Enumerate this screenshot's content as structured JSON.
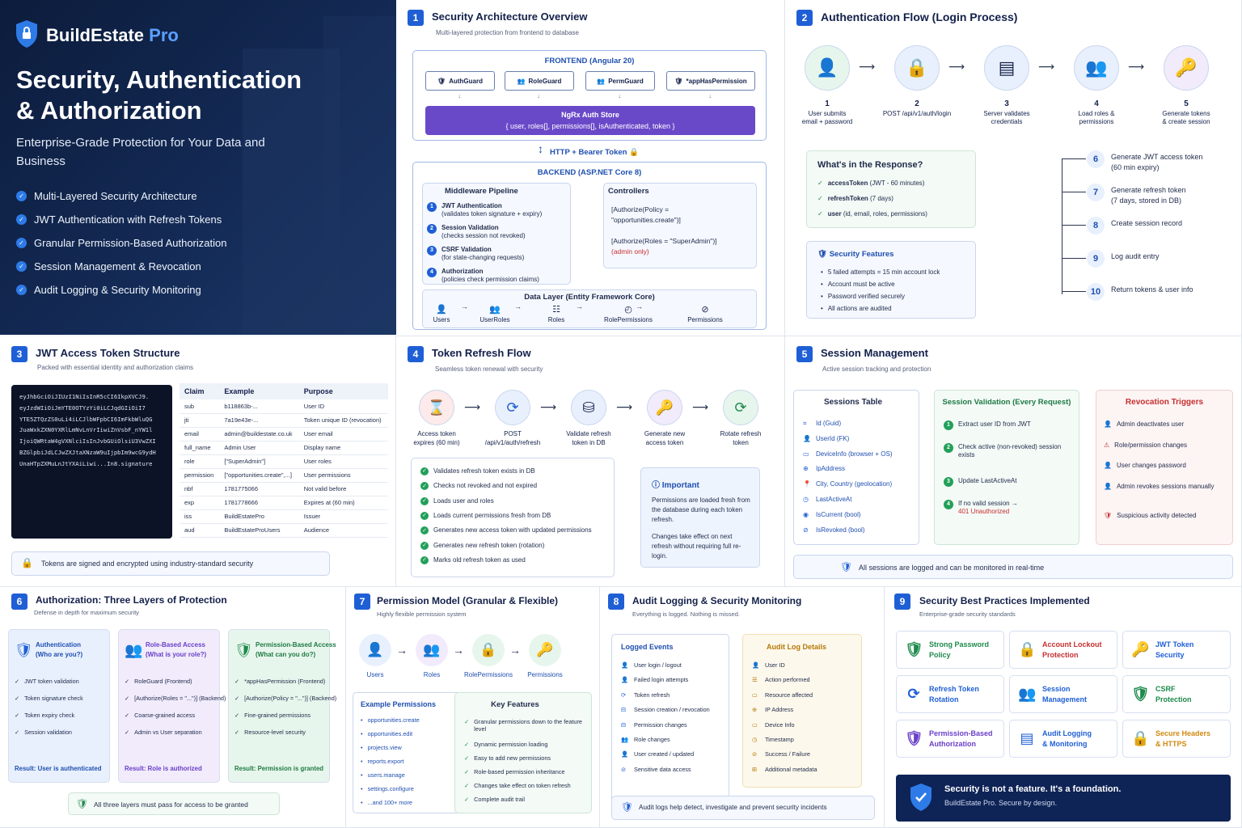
{
  "hero": {
    "brand1": "BuildEstate",
    "brand2": "Pro",
    "title1": "Security, Authentication",
    "title2": "& Authorization",
    "subtitle": "Enterprise-Grade Protection for Your Data and Business",
    "features": [
      "Multi-Layered Security Architecture",
      "JWT Authentication with Refresh Tokens",
      "Granular Permission-Based Authorization",
      "Session Management & Revocation",
      "Audit Logging & Security Monitoring"
    ]
  },
  "p1": {
    "num": "1",
    "title": "Security Architecture Overview",
    "subtitle": "Multi-layered protection from frontend to database",
    "frontend": "FRONTEND (Angular 20)",
    "guards": [
      "AuthGuard",
      "RoleGuard",
      "PermGuard",
      "*appHasPermission"
    ],
    "store_title": "NgRx Auth Store",
    "store_sub": "{ user, roles[], permissions[], isAuthenticated, token }",
    "http": "HTTP + Bearer Token",
    "backend": "BACKEND (ASP.NET Core 8)",
    "mw_title": "Middleware Pipeline",
    "mw": [
      {
        "n": "1",
        "t": "JWT Authentication",
        "s": "(validates token signature + expiry)"
      },
      {
        "n": "2",
        "t": "Session Validation",
        "s": "(checks session not revoked)"
      },
      {
        "n": "3",
        "t": "CSRF Validation",
        "s": "(for state-changing requests)"
      },
      {
        "n": "4",
        "t": "Authorization",
        "s": "(policies check permission claims)"
      }
    ],
    "ctrl_title": "Controllers",
    "ctrl1": "[Authorize(Policy =",
    "ctrl1b": "\"opportunities.create\")]",
    "ctrl2": "[Authorize(Roles = \"SuperAdmin\")]",
    "ctrl2b": "(admin only)",
    "data_title": "Data Layer (Entity Framework Core)",
    "entities": [
      "Users",
      "UserRoles",
      "Roles",
      "RolePermissions",
      "Permissions"
    ]
  },
  "p2": {
    "num": "2",
    "title": "Authentication Flow (Login Process)",
    "steps": [
      {
        "n": "1",
        "t": "User submits",
        "t2": "email + password"
      },
      {
        "n": "2",
        "t": "POST /api/v1/auth/login",
        "t2": ""
      },
      {
        "n": "3",
        "t": "Server validates",
        "t2": "credentials"
      },
      {
        "n": "4",
        "t": "Load roles &",
        "t2": "permissions"
      },
      {
        "n": "5",
        "t": "Generate tokens",
        "t2": "& create session"
      }
    ],
    "resp_title": "What's in the Response?",
    "resp": [
      {
        "b": "accessToken",
        "r": " (JWT - 60 minutes)"
      },
      {
        "b": "refreshToken",
        "r": " (7 days)"
      },
      {
        "b": "user",
        "r": " (id, email, roles, permissions)"
      }
    ],
    "sec_title": "Security Features",
    "sec": [
      "5 failed attempts = 15 min account lock",
      "Account must be active",
      "Password verified securely",
      "All actions are audited"
    ],
    "more": [
      {
        "n": "6",
        "t": "Generate JWT access token",
        "t2": "(60 min expiry)"
      },
      {
        "n": "7",
        "t": "Generate refresh token",
        "t2": "(7 days, stored in DB)"
      },
      {
        "n": "8",
        "t": "Create session record",
        "t2": ""
      },
      {
        "n": "9",
        "t": "Log audit entry",
        "t2": ""
      },
      {
        "n": "10",
        "t": "Return tokens & user info",
        "t2": ""
      }
    ]
  },
  "p3": {
    "num": "3",
    "title": "JWT Access Token Structure",
    "subtitle": "Packed with essential identity and authorization claims",
    "token": [
      "eyJhbGciOiJIUzI1NiIsInR5cCI6IkpXVCJ9.",
      "eyJzdWIiOiJmYTE0OTYzYi0iLCJqdGIiOiI7",
      "YTE5ZTQzZS0uLi4iLCJlbWFpbCI6ImFkbWluQG",
      "JuaWxkZXN0YXRlLmNvLnVrIiwiZnVsbF_nYW1l",
      "IjoiQWRtaW4gVXNlciIsInJvbGUiOlsiU3VwZXI",
      "BZGlpbiJdLCJwZXJtaXNzaW9uIjpbIm9wcG9ydH",
      "UnaHTpZXMuLnJtYXAiLiwi...In8.signature"
    ],
    "headers": [
      "Claim",
      "Example",
      "Purpose"
    ],
    "rows": [
      [
        "sub",
        "b118863b-...",
        "User ID"
      ],
      [
        "jti",
        "7a19e43e-...",
        "Token unique ID (revocation)"
      ],
      [
        "email",
        "admin@buildestate.co.uk",
        "User email"
      ],
      [
        "full_name",
        "Admin User",
        "Display name"
      ],
      [
        "role",
        "[\"SuperAdmin\"]",
        "User roles"
      ],
      [
        "permission",
        "[\"opportunities.create\",...]",
        "User permissions"
      ],
      [
        "nbf",
        "1781775066",
        "Not valid before"
      ],
      [
        "exp",
        "1781778666",
        "Expires at (60 min)"
      ],
      [
        "iss",
        "BuildEstatePro",
        "Issuer"
      ],
      [
        "aud",
        "BuildEstateProUsers",
        "Audience"
      ]
    ],
    "note": "Tokens are signed and encrypted using industry-standard security"
  },
  "p4": {
    "num": "4",
    "title": "Token Refresh Flow",
    "subtitle": "Seamless token renewal with security",
    "steps": [
      {
        "t": "Access token",
        "t2": "expires (60 min)"
      },
      {
        "t": "POST",
        "t2": "/api/v1/auth/refresh"
      },
      {
        "t": "Validate refresh",
        "t2": "token in DB"
      },
      {
        "t": "Generate new",
        "t2": "access token"
      },
      {
        "t": "Rotate refresh",
        "t2": "token"
      }
    ],
    "checks": [
      "Validates refresh token exists in DB",
      "Checks not revoked and not expired",
      "Loads user and roles",
      "Loads current permissions fresh from DB",
      "Generates new access token with updated permissions",
      "Generates new refresh token (rotation)",
      "Marks old refresh token as used"
    ],
    "imp_title": "Important",
    "imp1": "Permissions are loaded fresh from the database during each token refresh.",
    "imp2": "Changes take effect on next refresh without requiring full re-login."
  },
  "p5": {
    "num": "5",
    "title": "Session Management",
    "subtitle": "Active session tracking and protection",
    "tbl_title": "Sessions Table",
    "fields": [
      "Id (Guid)",
      "UserId (FK)",
      "DeviceInfo (browser + OS)",
      "IpAddress",
      "City, Country (geolocation)",
      "LastActiveAt",
      "IsCurrent (bool)",
      "IsRevoked (bool)"
    ],
    "val_title": "Session Validation (Every Request)",
    "val": [
      {
        "n": "1",
        "t": "Extract user ID from JWT",
        "r": ""
      },
      {
        "n": "2",
        "t": "Check active (non-revoked) session exists",
        "r": ""
      },
      {
        "n": "3",
        "t": "Update LastActiveAt",
        "r": ""
      },
      {
        "n": "4",
        "t": "If no valid session →",
        "r": "401 Unauthorized"
      }
    ],
    "rev_title": "Revocation Triggers",
    "rev": [
      "Admin deactivates user",
      "Role/permission changes",
      "User changes password",
      "Admin revokes sessions manually",
      "Suspicious activity detected"
    ],
    "note": "All sessions are logged and can be monitored in real-time"
  },
  "p6": {
    "num": "6",
    "title": "Authorization: Three Layers of Protection",
    "subtitle": "Defense in depth for maximum security",
    "cols": [
      {
        "t": "Authentication",
        "t2": "(Who are you?)",
        "items": [
          "JWT token validation",
          "Token signature check",
          "Token expiry check",
          "Session validation"
        ],
        "res": "Result: User is authenticated"
      },
      {
        "t": "Role-Based Access",
        "t2": "(What is your role?)",
        "items": [
          "RoleGuard (Frontend)",
          "[Authorize(Roles = \"...\")] (Backend)",
          "Coarse-grained access",
          "Admin vs User separation"
        ],
        "res": "Result: Role is authorized"
      },
      {
        "t": "Permission-Based Access",
        "t2": "(What can you do?)",
        "items": [
          "*appHasPermission (Frontend)",
          "[Authorize(Policy = \"...\")] (Backend)",
          "Fine-grained permissions",
          "Resource-level security"
        ],
        "res": "Result: Permission is granted"
      }
    ],
    "note": "All three layers must pass for access to be granted"
  },
  "p7": {
    "num": "7",
    "title": "Permission Model (Granular & Flexible)",
    "subtitle": "Highly flexible permission system",
    "chain": [
      "Users",
      "Roles",
      "RolePermissions",
      "Permissions"
    ],
    "ex_title": "Example Permissions",
    "ex": [
      "opportunities.create",
      "opportunities.edit",
      "projects.view",
      "reports.export",
      "users.manage",
      "settings.configure",
      "...and 100+ more"
    ],
    "kf_title": "Key Features",
    "kf": [
      "Granular permissions down to the feature level",
      "Dynamic permission loading",
      "Easy to add new permissions",
      "Role-based permission inheritance",
      "Changes take effect on token refresh",
      "Complete audit trail"
    ]
  },
  "p8": {
    "num": "8",
    "title": "Audit Logging & Security Monitoring",
    "subtitle": "Everything is logged. Nothing is missed.",
    "ev_title": "Logged Events",
    "ev": [
      "User login / logout",
      "Failed login attempts",
      "Token refresh",
      "Session creation / revocation",
      "Permission changes",
      "Role changes",
      "User created / updated",
      "Sensitive data access"
    ],
    "det_title": "Audit Log Details",
    "det": [
      "User ID",
      "Action performed",
      "Resource affected",
      "IP Address",
      "Device Info",
      "Timestamp",
      "Success / Failure",
      "Additional metadata"
    ],
    "note": "Audit logs help detect, investigate and prevent security incidents"
  },
  "p9": {
    "num": "9",
    "title": "Security Best Practices Implemented",
    "subtitle": "Enterprise-grade security standards",
    "cards": [
      {
        "t": "Strong Password",
        "t2": "Policy",
        "c": "#1e8a4c"
      },
      {
        "t": "Account Lockout",
        "t2": "Protection",
        "c": "#c62f2f"
      },
      {
        "t": "JWT Token",
        "t2": "Security",
        "c": "#1f5fd6"
      },
      {
        "t": "Refresh Token",
        "t2": "Rotation",
        "c": "#1f5fd6"
      },
      {
        "t": "Session",
        "t2": "Management",
        "c": "#1f5fd6"
      },
      {
        "t": "CSRF",
        "t2": "Protection",
        "c": "#1e8a4c"
      },
      {
        "t": "Permission-Based",
        "t2": "Authorization",
        "c": "#6a3fc8"
      },
      {
        "t": "Audit Logging",
        "t2": "& Monitoring",
        "c": "#1f5fd6"
      },
      {
        "t": "Secure Headers",
        "t2": "& HTTPS",
        "c": "#d08a12"
      }
    ],
    "banner1": "Security is not a feature. It's a foundation.",
    "banner2": "BuildEstate Pro. Secure by design."
  }
}
